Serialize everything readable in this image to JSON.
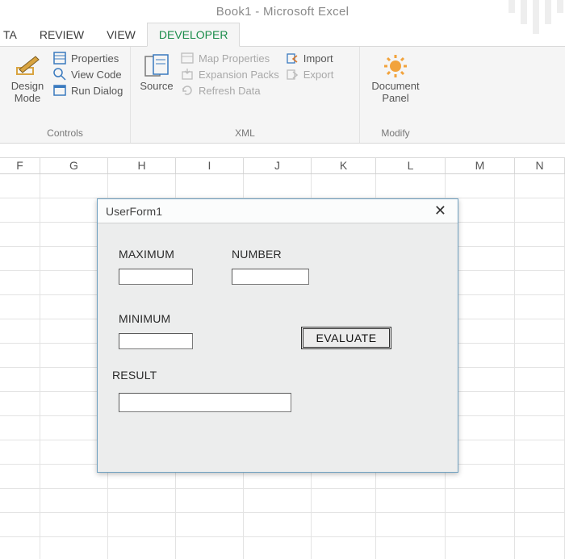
{
  "app_title": "Book1 - Microsoft Excel",
  "tabs": {
    "data": "TA",
    "review": "REVIEW",
    "view": "VIEW",
    "developer": "DEVELOPER"
  },
  "ribbon": {
    "controls": {
      "design_mode": "Design\nMode",
      "properties": "Properties",
      "view_code": "View Code",
      "run_dialog": "Run Dialog",
      "group_label": "Controls"
    },
    "xml": {
      "source": "Source",
      "map_properties": "Map Properties",
      "expansion_packs": "Expansion Packs",
      "refresh_data": "Refresh Data",
      "import": "Import",
      "export": "Export",
      "group_label": "XML"
    },
    "modify": {
      "document_panel": "Document\nPanel",
      "group_label": "Modify"
    }
  },
  "columns": [
    "F",
    "G",
    "H",
    "I",
    "J",
    "K",
    "L",
    "M",
    "N"
  ],
  "userform": {
    "title": "UserForm1",
    "close": "✕",
    "labels": {
      "maximum": "MAXIMUM",
      "number": "NUMBER",
      "minimum": "MINIMUM",
      "result": "RESULT"
    },
    "values": {
      "maximum": "",
      "number": "",
      "minimum": "",
      "result": ""
    },
    "evaluate": "EVALUATE"
  }
}
